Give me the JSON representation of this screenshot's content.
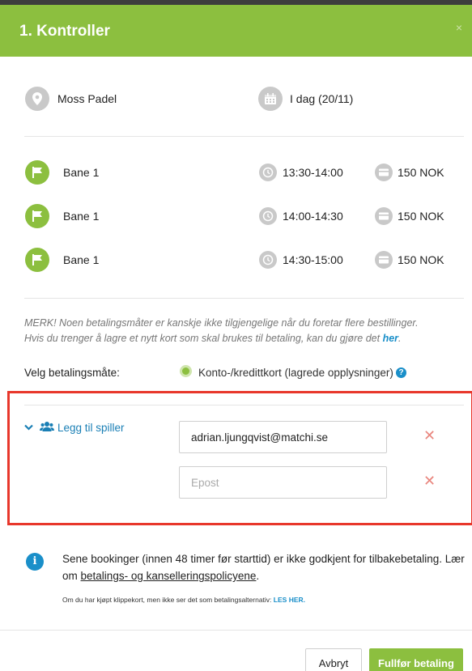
{
  "header": {
    "title": "1. Kontroller",
    "close": "×"
  },
  "booking": {
    "venue": "Moss Padel",
    "date": "I dag (20/11)"
  },
  "courts": [
    {
      "name": "Bane 1",
      "time": "13:30-14:00",
      "price": "150 NOK"
    },
    {
      "name": "Bane 1",
      "time": "14:00-14:30",
      "price": "150 NOK"
    },
    {
      "name": "Bane 1",
      "time": "14:30-15:00",
      "price": "150 NOK"
    }
  ],
  "notice": {
    "line1": "MERK! Noen betalingsmåter er kanskje ikke tilgjengelige når du foretar flere bestillinger.",
    "line2": "Hvis du trenger å lagre et nytt kort som skal brukes til betaling, kan du gjøre det",
    "link": "her",
    "end": "."
  },
  "payment": {
    "label": "Velg betalingsmåte:",
    "option": "Konto-/kredittkort (lagrede opplysninger)"
  },
  "players": {
    "label": "Legg til spiller",
    "email1": "adrian.ljungqvist@matchi.se",
    "email2_placeholder": "Epost"
  },
  "info": {
    "text": "Sene bookinger (innen 48 timer før starttid) er ikke godkjent for tilbakebetaling. Lær om",
    "link": "betalings- og kanselleringspolicyene",
    "end": ".",
    "small": "Om du har kjøpt klippekort, men ikke ser det som betalingsalternativ:",
    "small_link": "LES HER."
  },
  "buttons": {
    "cancel": "Avbryt",
    "submit": "Fullfør betaling"
  }
}
